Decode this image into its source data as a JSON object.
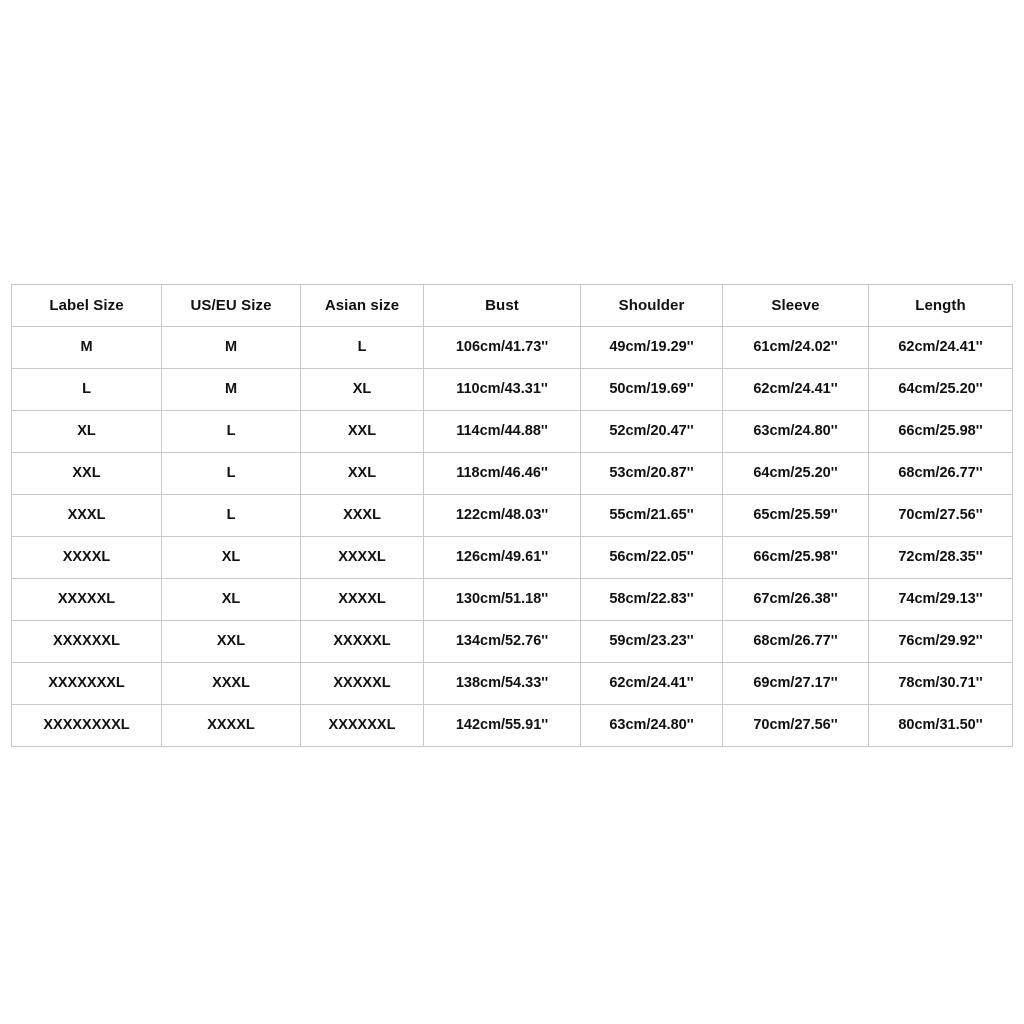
{
  "table": {
    "columns": [
      "Label Size",
      "US/EU Size",
      "Asian size",
      "Bust",
      "Shoulder",
      "Sleeve",
      "Length"
    ],
    "rows": [
      [
        "M",
        "M",
        "L",
        "106cm/41.73''",
        "49cm/19.29''",
        "61cm/24.02''",
        "62cm/24.41''"
      ],
      [
        "L",
        "M",
        "XL",
        "110cm/43.31''",
        "50cm/19.69''",
        "62cm/24.41''",
        "64cm/25.20''"
      ],
      [
        "XL",
        "L",
        "XXL",
        "114cm/44.88''",
        "52cm/20.47''",
        "63cm/24.80''",
        "66cm/25.98''"
      ],
      [
        "XXL",
        "L",
        "XXL",
        "118cm/46.46''",
        "53cm/20.87''",
        "64cm/25.20''",
        "68cm/26.77''"
      ],
      [
        "XXXL",
        "L",
        "XXXL",
        "122cm/48.03''",
        "55cm/21.65''",
        "65cm/25.59''",
        "70cm/27.56''"
      ],
      [
        "XXXXL",
        "XL",
        "XXXXL",
        "126cm/49.61''",
        "56cm/22.05''",
        "66cm/25.98''",
        "72cm/28.35''"
      ],
      [
        "XXXXXL",
        "XL",
        "XXXXL",
        "130cm/51.18''",
        "58cm/22.83''",
        "67cm/26.38''",
        "74cm/29.13''"
      ],
      [
        "XXXXXXL",
        "XXL",
        "XXXXXL",
        "134cm/52.76''",
        "59cm/23.23''",
        "68cm/26.77''",
        "76cm/29.92''"
      ],
      [
        "XXXXXXXL",
        "XXXL",
        "XXXXXL",
        "138cm/54.33''",
        "62cm/24.41''",
        "69cm/27.17''",
        "78cm/30.71''"
      ],
      [
        "XXXXXXXXL",
        "XXXXL",
        "XXXXXXL",
        "142cm/55.91''",
        "63cm/24.80''",
        "70cm/27.56''",
        "80cm/31.50''"
      ]
    ]
  },
  "colors": {
    "background": "#ffffff",
    "border": "#c9c9c9",
    "text": "#111111"
  }
}
